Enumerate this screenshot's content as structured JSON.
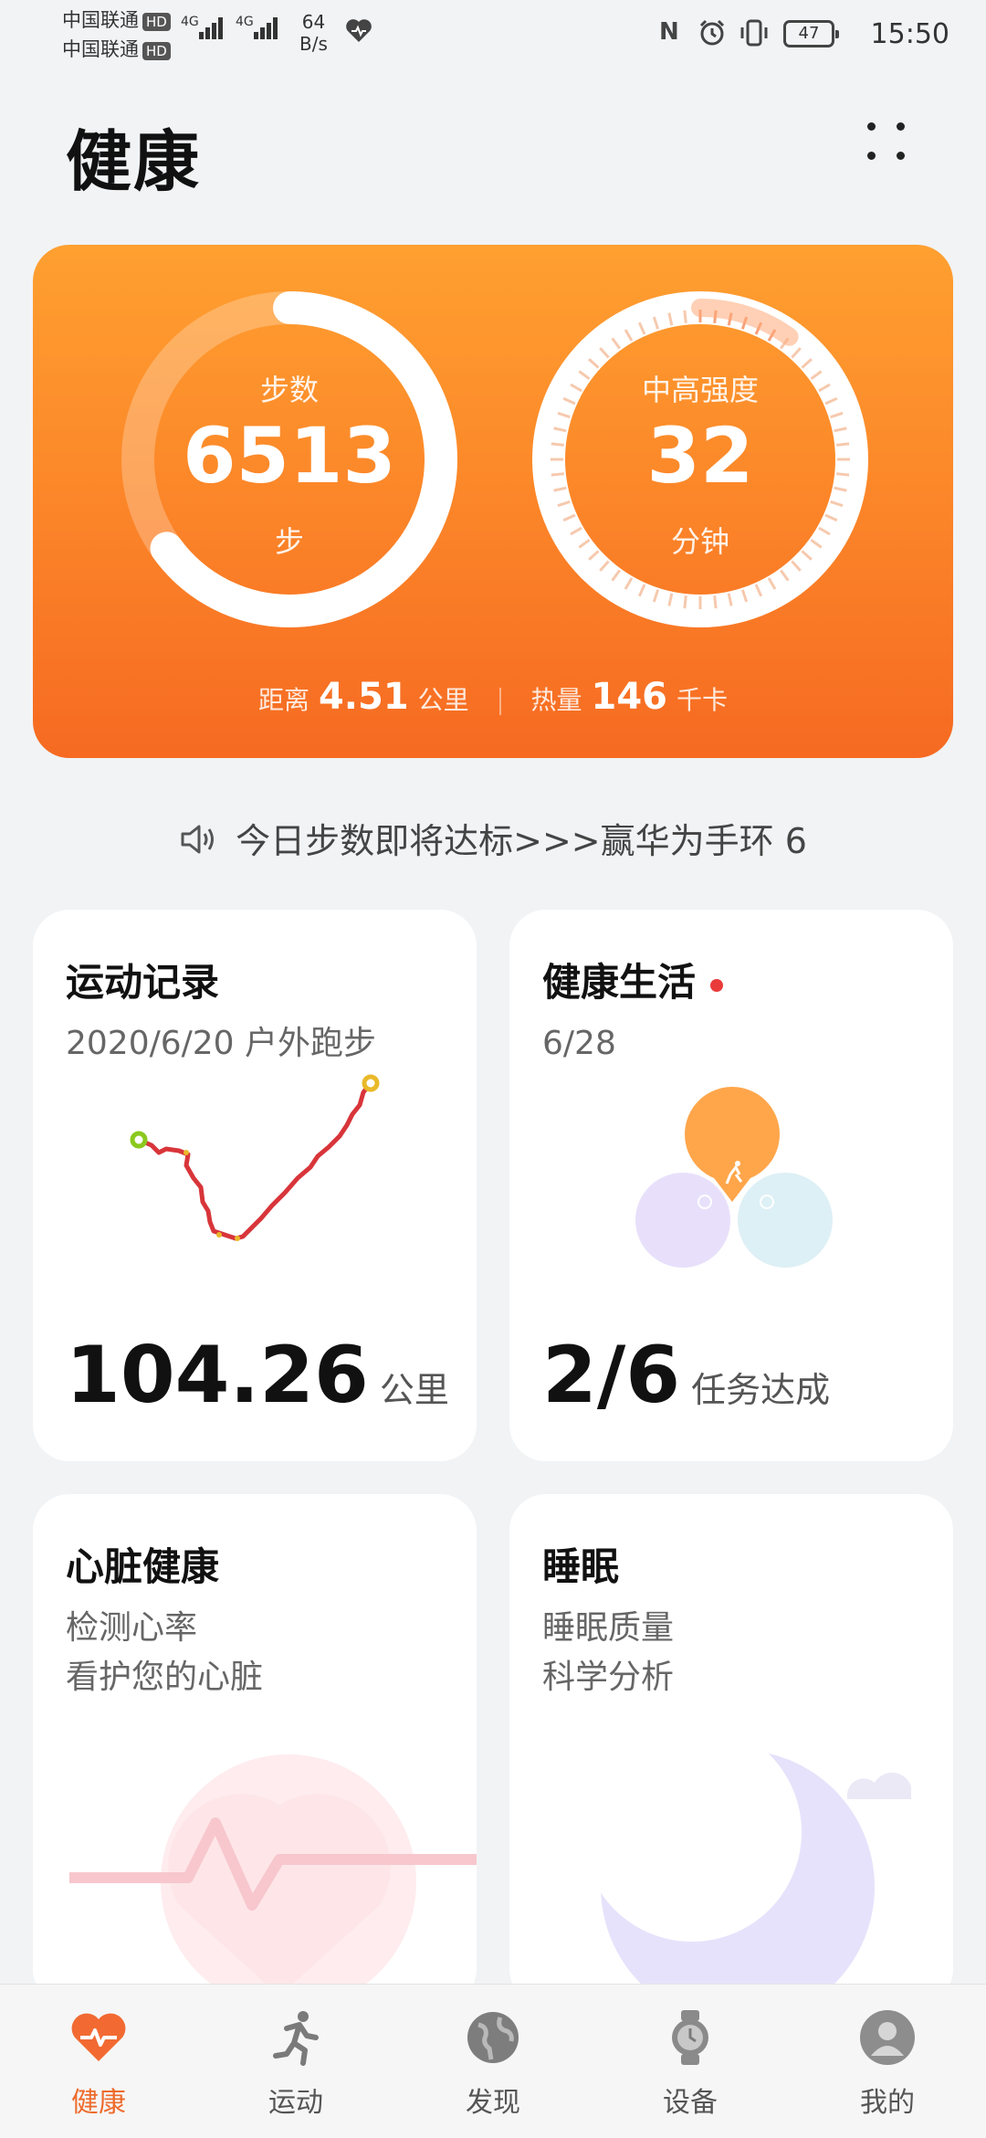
{
  "status_bar": {
    "carrier_1": "中国联通",
    "carrier_2": "中国联通",
    "hd": "HD",
    "network_1": "4G",
    "network_2": "4G",
    "speed_value": "64",
    "speed_unit": "B/s",
    "battery": "47",
    "time": "15:50"
  },
  "header": {
    "title": "健康"
  },
  "hero": {
    "steps": {
      "label": "步数",
      "value": "6513",
      "unit": "步",
      "progress": 0.65
    },
    "intensity": {
      "label": "中高强度",
      "value": "32",
      "unit": "分钟",
      "progress": 0.1
    },
    "distance": {
      "label": "距离",
      "value": "4.51",
      "unit": "公里"
    },
    "calories": {
      "label": "热量",
      "value": "146",
      "unit": "千卡"
    }
  },
  "marquee": {
    "text": "今日步数即将达标>>>赢华为手环 6"
  },
  "cards": {
    "exercise": {
      "title": "运动记录",
      "subtitle": "2020/6/20 户外跑步",
      "value": "104.26",
      "unit": "公里"
    },
    "healthy_life": {
      "title": "健康生活",
      "subtitle": "6/28",
      "value": "2/6",
      "unit": "任务达成"
    },
    "heart": {
      "title": "心脏健康",
      "line1": "检测心率",
      "line2": "看护您的心脏"
    },
    "sleep": {
      "title": "睡眠",
      "line1": "睡眠质量",
      "line2": "科学分析"
    }
  },
  "nav": {
    "items": [
      {
        "label": "健康",
        "icon": "heart-pulse-icon",
        "active": true
      },
      {
        "label": "运动",
        "icon": "runner-icon"
      },
      {
        "label": "发现",
        "icon": "globe-icon"
      },
      {
        "label": "设备",
        "icon": "watch-icon"
      },
      {
        "label": "我的",
        "icon": "user-icon"
      }
    ]
  },
  "colors": {
    "accent": "#f47a28",
    "nav_active": "#ee6b2c"
  }
}
